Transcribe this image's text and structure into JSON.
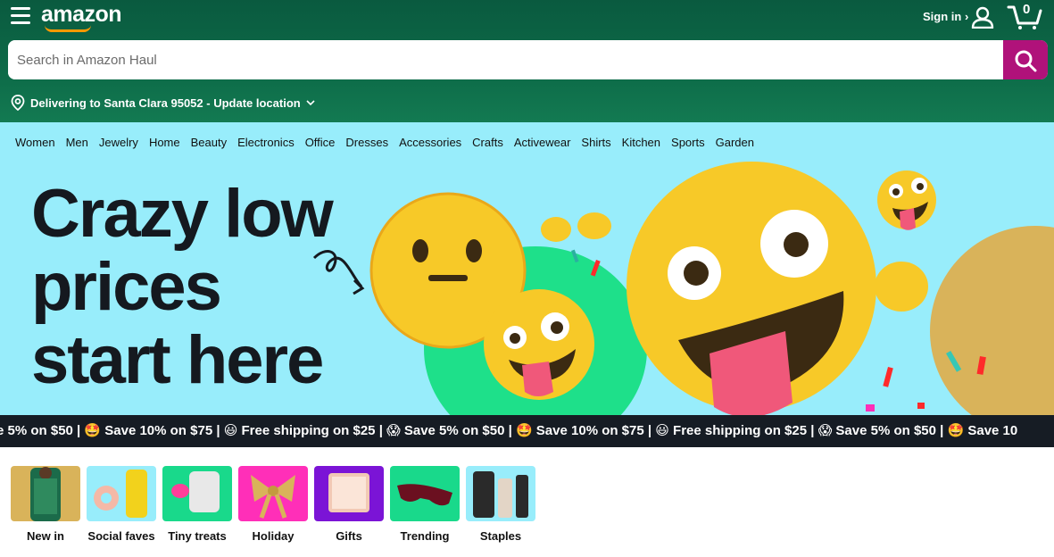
{
  "header": {
    "logo": "amazon",
    "signin_label": "Sign in ›",
    "cart_count": "0"
  },
  "search": {
    "placeholder": "Search in Amazon Haul"
  },
  "delivery": {
    "label": "Delivering to Santa Clara 95052 - Update location"
  },
  "nav": {
    "items": [
      "Women",
      "Men",
      "Jewelry",
      "Home",
      "Beauty",
      "Electronics",
      "Office",
      "Dresses",
      "Accessories",
      "Crafts",
      "Activewear",
      "Shirts",
      "Kitchen",
      "Sports",
      "Garden"
    ]
  },
  "hero": {
    "line1": "Crazy low",
    "line2": "prices",
    "line3": "start here"
  },
  "ticker": {
    "text": "e 5% on $50 | 🤩 Save 10% on $75 | 😃 Free shipping on $25 | 😱 Save 5% on $50 | 🤩 Save 10% on $75 | 😃 Free shipping on $25 | 😱 Save 5% on $50 | 🤩 Save 10"
  },
  "categories": [
    {
      "label": "New in",
      "color": "#d9b35a"
    },
    {
      "label": "Social faves",
      "color": "#98edfb"
    },
    {
      "label": "Tiny treats",
      "color": "#19d98b"
    },
    {
      "label": "Holiday",
      "color": "#ff2fb8"
    },
    {
      "label": "Gifts",
      "color": "#7b14d6"
    },
    {
      "label": "Trending",
      "color": "#19d98b"
    },
    {
      "label": "Staples",
      "color": "#98edfb"
    }
  ],
  "colors": {
    "header_green": "#0d6b48",
    "search_button": "#b0127a",
    "nav_bg": "#98edfb",
    "ticker_bg": "#161c24"
  }
}
